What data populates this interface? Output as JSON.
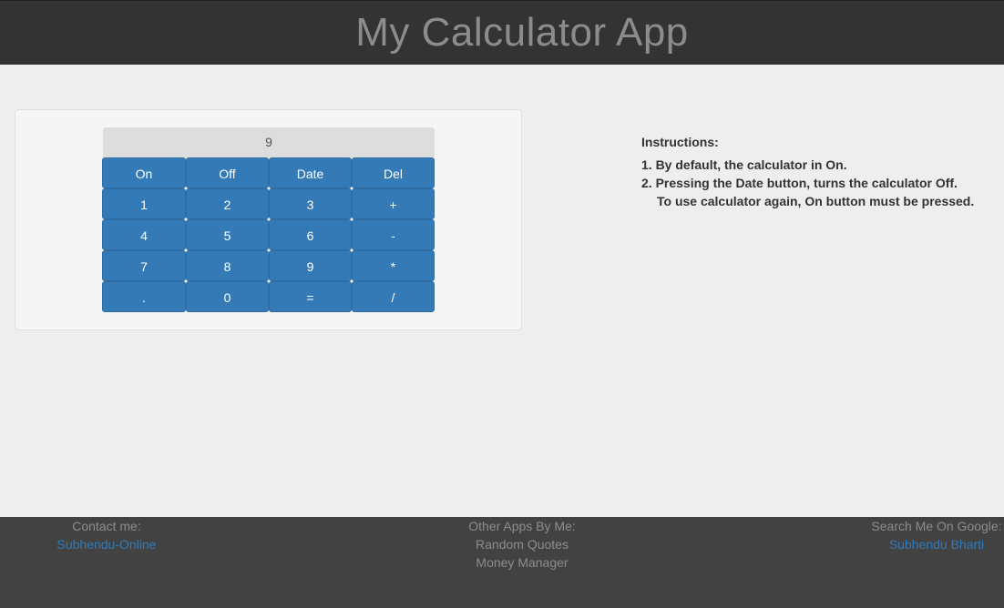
{
  "header": {
    "title": "My Calculator App"
  },
  "calculator": {
    "display": "9",
    "keys": [
      [
        "On",
        "Off",
        "Date",
        "Del"
      ],
      [
        "1",
        "2",
        "3",
        "+"
      ],
      [
        "4",
        "5",
        "6",
        "-"
      ],
      [
        "7",
        "8",
        "9",
        "*"
      ],
      [
        ".",
        "0",
        "=",
        "/"
      ]
    ]
  },
  "instructions": {
    "title": "Instructions:",
    "line1": "1. By default, the calculator in On.",
    "line2a": "2. Pressing the Date button, turns the calculator Off.",
    "line2b": "To use calculator again, On button must be pressed."
  },
  "footer": {
    "contact_label": "Contact me:",
    "contact_link": "Subhendu-Online",
    "apps_label": "Other Apps By Me:",
    "apps": [
      "Random Quotes",
      "Money Manager"
    ],
    "google_label": "Search Me On Google:",
    "google_link": "Subhendu Bharti"
  },
  "colors": {
    "header_bg": "#333333",
    "button_blue": "#337ab7",
    "footer_bg": "#424242",
    "link": "#337ab7"
  }
}
